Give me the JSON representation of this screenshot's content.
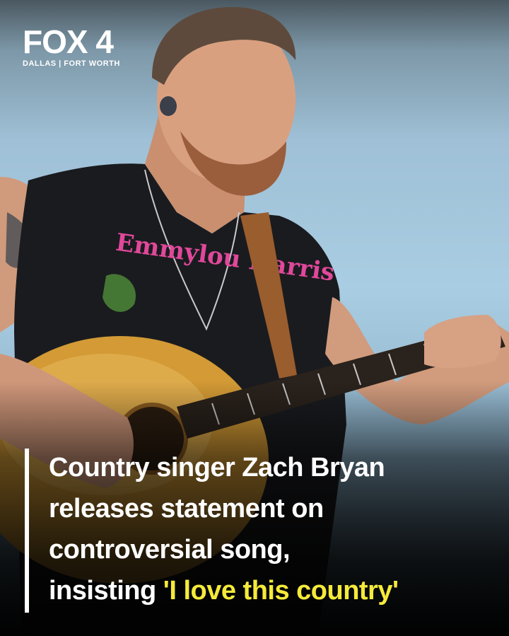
{
  "logo": {
    "main": "FOX 4",
    "sub": "DALLAS | FORT WORTH"
  },
  "headline": {
    "line1": "Country singer Zach Bryan",
    "line2": "releases statement on",
    "line3": "controversial song,",
    "line4_prefix": "insisting ",
    "line4_quote": "'I love this country'"
  },
  "colors": {
    "highlight": "#f5ea3a",
    "text": "#ffffff",
    "sky": "#a9cde2"
  }
}
